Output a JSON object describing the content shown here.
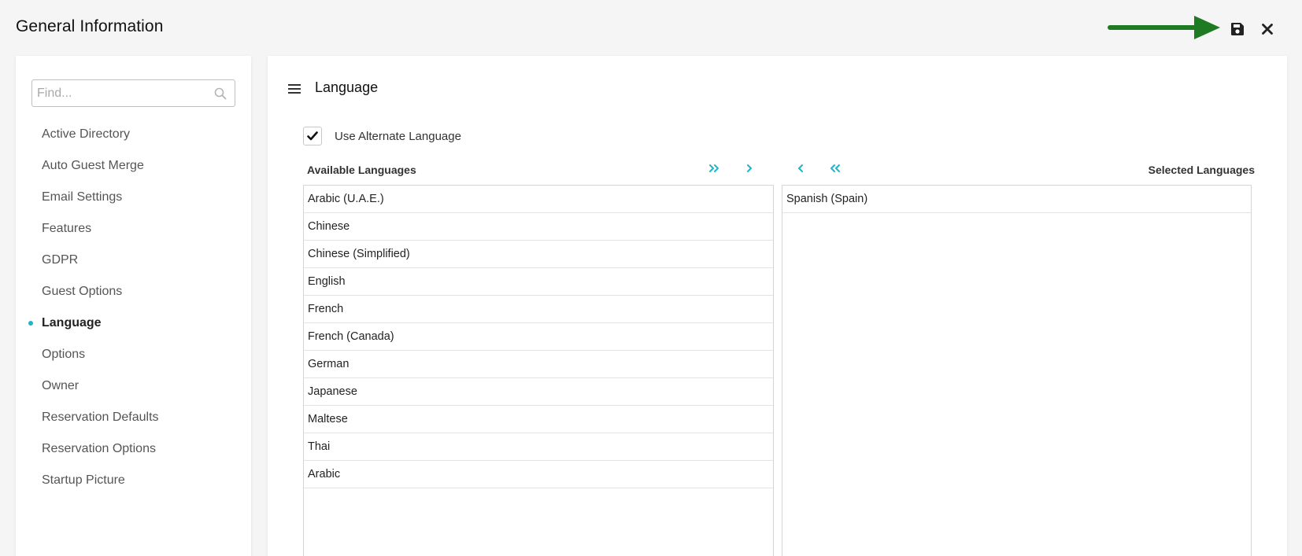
{
  "header": {
    "title": "General Information",
    "save_icon": "save-icon",
    "close_icon": "close-icon",
    "arrow_color": "#1e7b24"
  },
  "sidebar": {
    "search": {
      "placeholder": "Find...",
      "value": ""
    },
    "items": [
      {
        "label": "Active Directory",
        "active": false
      },
      {
        "label": "Auto Guest Merge",
        "active": false
      },
      {
        "label": "Email Settings",
        "active": false
      },
      {
        "label": "Features",
        "active": false
      },
      {
        "label": "GDPR",
        "active": false
      },
      {
        "label": "Guest Options",
        "active": false
      },
      {
        "label": "Language",
        "active": true
      },
      {
        "label": "Options",
        "active": false
      },
      {
        "label": "Owner",
        "active": false
      },
      {
        "label": "Reservation Defaults",
        "active": false
      },
      {
        "label": "Reservation Options",
        "active": false
      },
      {
        "label": "Startup Picture",
        "active": false
      }
    ],
    "accent_color": "#1fb5c8"
  },
  "main": {
    "section_title": "Language",
    "use_alternate": {
      "label": "Use Alternate Language",
      "checked": true
    },
    "available": {
      "header": "Available Languages",
      "items": [
        "Arabic (U.A.E.)",
        "Chinese",
        "Chinese (Simplified)",
        "English",
        "French",
        "French (Canada)",
        "German",
        "Japanese",
        "Maltese",
        "Thai",
        "Arabic"
      ]
    },
    "selected": {
      "header": "Selected Languages",
      "items": [
        "Spanish (Spain)"
      ]
    },
    "mover_color": "#1fb5c8"
  }
}
